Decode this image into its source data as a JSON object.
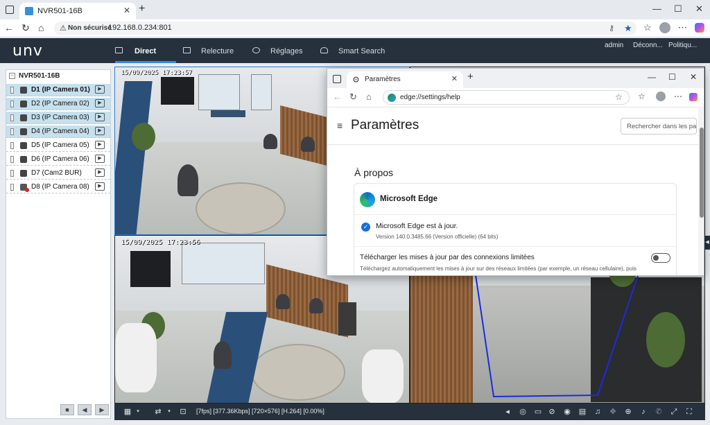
{
  "browser": {
    "tab_title": "NVR501-16B",
    "tab_close": "✕",
    "new_tab": "+",
    "address_insecure": "Non sécurisé",
    "address_url": "192.168.0.234:801"
  },
  "nvr": {
    "logo": "unv",
    "tabs": [
      {
        "label": "Direct",
        "active": true
      },
      {
        "label": "Relecture",
        "active": false
      },
      {
        "label": "Réglages",
        "active": false
      },
      {
        "label": "Smart Search",
        "active": false
      }
    ],
    "user": "admin",
    "logout": "Déconn...",
    "policy": "Politiqu...",
    "device_name": "NVR501-16B",
    "cameras": [
      {
        "label": "D1 (IP Camera 01)",
        "selected": true,
        "bold": true,
        "error": false
      },
      {
        "label": "D2 (IP Camera 02)",
        "selected": true,
        "bold": false,
        "error": false
      },
      {
        "label": "D3 (IP Camera 03)",
        "selected": true,
        "bold": false,
        "error": false
      },
      {
        "label": "D4 (IP Camera 04)",
        "selected": true,
        "bold": false,
        "error": false
      },
      {
        "label": "D5 (IP Camera 05)",
        "selected": false,
        "bold": false,
        "error": false
      },
      {
        "label": "D6 (IP Camera 06)",
        "selected": false,
        "bold": false,
        "error": false
      },
      {
        "label": "D7 (Cam2 BUR)",
        "selected": false,
        "bold": false,
        "error": false
      },
      {
        "label": "D8 (IP Camera 08)",
        "selected": false,
        "bold": false,
        "error": true
      }
    ],
    "osd_tile1": "15/09/2025 17:23:57",
    "osd_tile2": "15/09/2025 17:23:56",
    "stream_status": "[7fps] [377.36Kbps] [720×576] [H.264] [0.00%]"
  },
  "settings_popup": {
    "tab_title": "Paramètres",
    "tab_close": "✕",
    "new_tab": "+",
    "url": "edge://settings/help",
    "heading": "Paramètres",
    "search_placeholder": "Rechercher dans les par",
    "section_title": "À propos",
    "product_name": "Microsoft Edge",
    "status": "Microsoft Edge est à jour.",
    "version": "Version 140.0.3485.66 (Version officielle) (64 bits)",
    "download_title": "Télécharger les mises à jour par des connexions limitées",
    "download_desc": "Téléchargez automatiquement les mises à jour sur des réseaux limitées (par exemple, un réseau cellulaire), puis",
    "toggle_on": false
  },
  "colors": {
    "nvr_header": "#26313d",
    "accent": "#2e8be8",
    "selected_row": "#c6e0ee",
    "edge_check": "#1a6dd9"
  }
}
